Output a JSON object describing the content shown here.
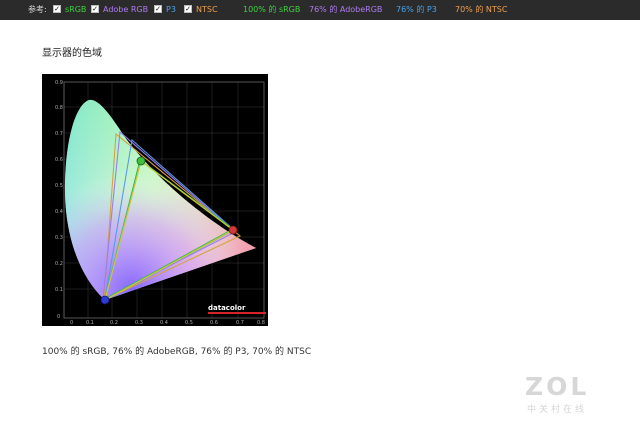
{
  "legend_bar": {
    "label": "参考:",
    "items": [
      {
        "label": "sRGB",
        "checked": true,
        "color": "#3ed33e"
      },
      {
        "label": "Adobe RGB",
        "checked": true,
        "color": "#b07cf2"
      },
      {
        "label": "P3",
        "checked": true,
        "color": "#4aa3f0"
      },
      {
        "label": "NTSC",
        "checked": true,
        "color": "#f0a050"
      }
    ],
    "coverage": [
      {
        "text": "100% 的 sRGB",
        "color": "#3ed33e"
      },
      {
        "text": "76% 的 AdobeRGB",
        "color": "#b07cf2"
      },
      {
        "text": "76% 的 P3",
        "color": "#4aa3f0"
      },
      {
        "text": "70% 的 NTSC",
        "color": "#f0a050"
      }
    ]
  },
  "section": {
    "title": "显示器的色域"
  },
  "chart": {
    "brand": "datacolor",
    "y_ticks": [
      "0.9",
      "0.8",
      "0.7",
      "0.6",
      "0.5",
      "0.4",
      "0.3",
      "0.2",
      "0.1",
      "0"
    ],
    "x_ticks": [
      "0",
      "0.1",
      "0.2",
      "0.3",
      "0.4",
      "0.5",
      "0.6",
      "0.7",
      "0.8"
    ]
  },
  "caption": "100% 的 sRGB, 76% 的 AdobeRGB, 76% 的 P3, 70% 的 NTSC",
  "watermark": {
    "logo": "ZOL",
    "sub": "中关村在线"
  }
}
